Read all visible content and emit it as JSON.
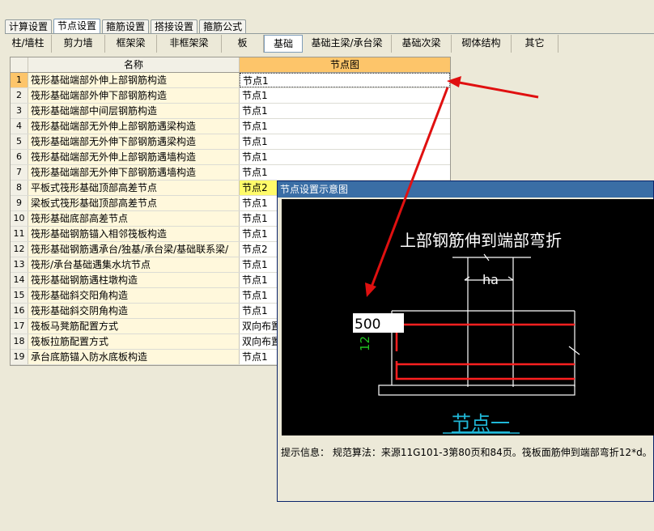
{
  "tabs": [
    "计算设置",
    "节点设置",
    "箍筋设置",
    "搭接设置",
    "箍筋公式"
  ],
  "active_tab": 1,
  "subtabs": [
    "柱/墙柱",
    "剪力墙",
    "框架梁",
    "非框架梁",
    "板",
    "基础",
    "基础主梁/承台梁",
    "基础次梁",
    "砌体结构",
    "其它"
  ],
  "active_subtab": 5,
  "grid": {
    "headers": [
      "名称",
      "节点图"
    ],
    "rows": [
      {
        "num": "1",
        "name": "筏形基础端部外伸上部钢筋构造",
        "node": "节点1"
      },
      {
        "num": "2",
        "name": "筏形基础端部外伸下部钢筋构造",
        "node": "节点1"
      },
      {
        "num": "3",
        "name": "筏形基础端部中间层钢筋构造",
        "node": "节点1"
      },
      {
        "num": "4",
        "name": "筏形基础端部无外伸上部钢筋遇梁构造",
        "node": "节点1"
      },
      {
        "num": "5",
        "name": "筏形基础端部无外伸下部钢筋遇梁构造",
        "node": "节点1"
      },
      {
        "num": "6",
        "name": "筏形基础端部无外伸上部钢筋遇墙构造",
        "node": "节点1"
      },
      {
        "num": "7",
        "name": "筏形基础端部无外伸下部钢筋遇墙构造",
        "node": "节点1"
      },
      {
        "num": "8",
        "name": "平板式筏形基础顶部高差节点",
        "node": "节点2"
      },
      {
        "num": "9",
        "name": "梁板式筏形基础顶部高差节点",
        "node": "节点1"
      },
      {
        "num": "10",
        "name": "筏形基础底部高差节点",
        "node": "节点1"
      },
      {
        "num": "11",
        "name": "筏形基础钢筋锚入相邻筏板构造",
        "node": "节点1"
      },
      {
        "num": "12",
        "name": "筏形基础钢筋遇承台/独基/承台梁/基础联系梁/",
        "node": "节点2"
      },
      {
        "num": "13",
        "name": "筏形/承台基础遇集水坑节点",
        "node": "节点1"
      },
      {
        "num": "14",
        "name": "筏形基础钢筋遇柱墩构造",
        "node": "节点1"
      },
      {
        "num": "15",
        "name": "筏形基础斜交阳角构造",
        "node": "节点1"
      },
      {
        "num": "16",
        "name": "筏形基础斜交阴角构造",
        "node": "节点1"
      },
      {
        "num": "17",
        "name": "筏板马凳筋配置方式",
        "node": "双向布置"
      },
      {
        "num": "18",
        "name": "筏板拉筋配置方式",
        "node": "双向布置"
      },
      {
        "num": "19",
        "name": "承台底筋锚入防水底板构造",
        "node": "节点1"
      }
    ]
  },
  "dialog": {
    "title": "节点设置示意图",
    "diagram_title": "上部钢筋伸到端部弯折",
    "dim_ha": "ha",
    "value_input": "500",
    "dim_12": "12",
    "node_label": "节点一",
    "hint": "提示信息： 规范算法：来源11G101-3第80页和84页。筏板面筋伸到端部弯折12*d。"
  },
  "colors": {
    "rebar": "#ff2020",
    "node_label": "#20b8d8",
    "dim_green": "#20c020",
    "arrow": "#e01010"
  }
}
